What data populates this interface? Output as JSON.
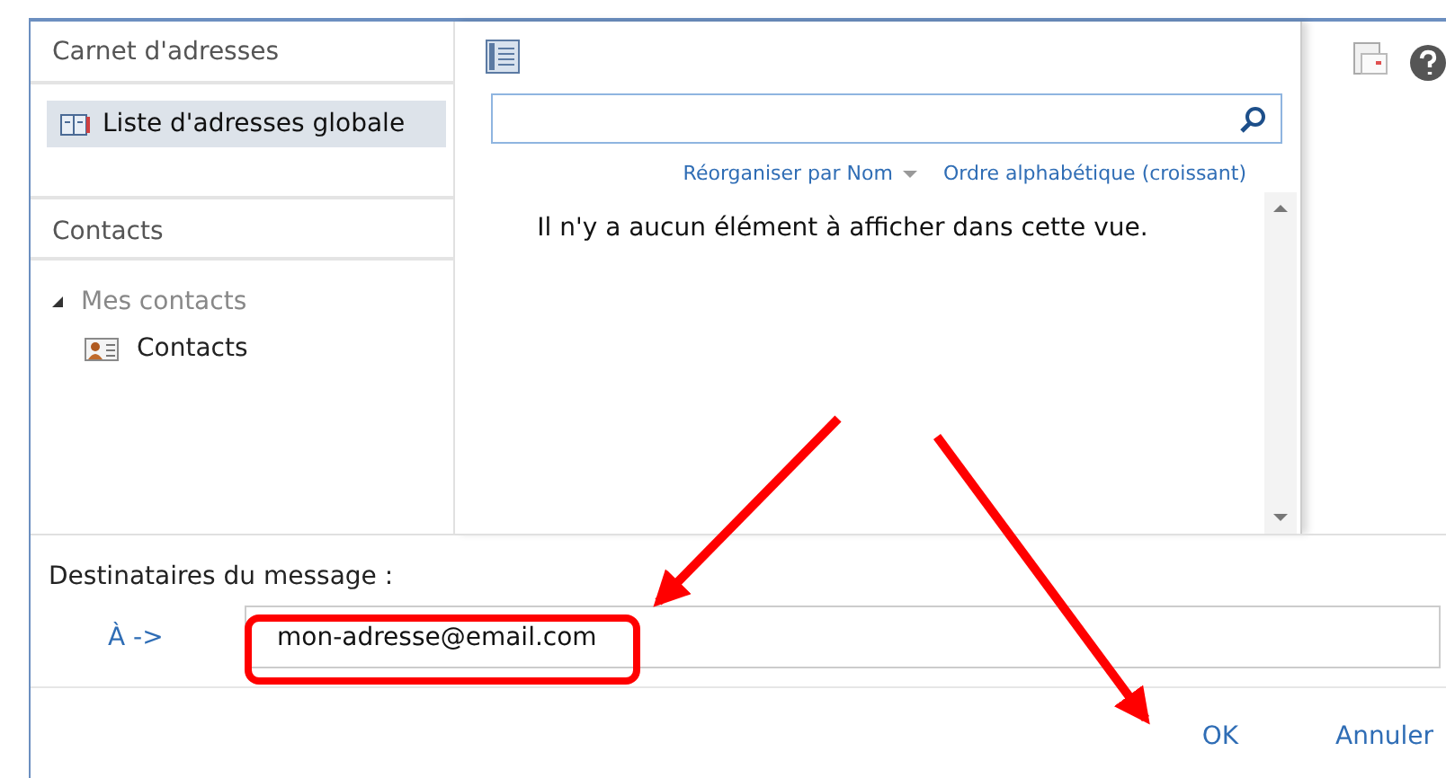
{
  "sidebar": {
    "title": "Carnet d'adresses",
    "items": [
      {
        "label": "Liste d'adresses globale",
        "selected": true
      }
    ],
    "section": "Contacts",
    "tree": [
      {
        "label": "Mes contacts",
        "expanded": true,
        "children": [
          {
            "label": "Contacts",
            "selected": false
          }
        ]
      }
    ]
  },
  "list": {
    "sort_links": [
      "Réorganiser par Nom",
      "Ordre alphabétique (croissant)"
    ],
    "empty_message": "Il n'y a aucun élément à afficher dans cette vue."
  },
  "recipients": {
    "label": "Destinataires du message :",
    "to_label": "À ->",
    "to_value": "mon-adresse@email.com"
  },
  "buttons": [
    "OK",
    "Annuler"
  ]
}
